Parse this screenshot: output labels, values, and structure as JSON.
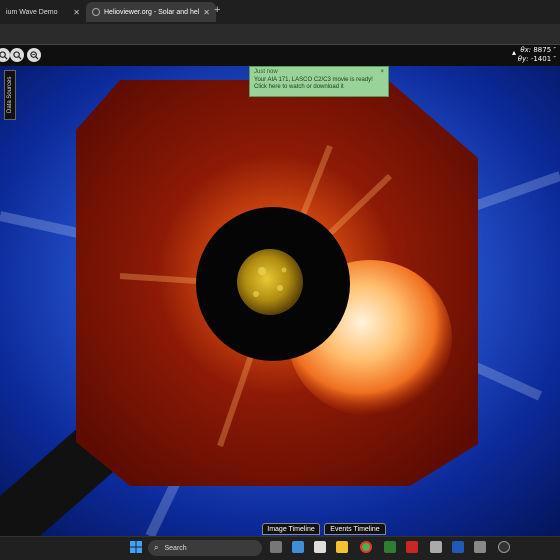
{
  "browser": {
    "tabs": [
      {
        "label": "ium Wave Demo"
      },
      {
        "label": "Helioviewer.org - Solar and hel"
      }
    ],
    "new_tab_symbol": "+",
    "close_symbol": "✕"
  },
  "toolbar": {
    "zoom_out_icon": "zoom-out-icon",
    "zoom_in_icon": "zoom-in-icon"
  },
  "coords": {
    "x_label": "θx:",
    "x_value": "8875 ″",
    "y_label": "θy:",
    "y_value": "-1401 ″"
  },
  "sidebar": {
    "data_sources_label": "Data Sources"
  },
  "notification": {
    "title": "Just now",
    "line1": "Your AIA 171, LASCO C2/C3 movie is ready!",
    "line2": "Click here to watch or download it",
    "close": "×"
  },
  "timeline": {
    "image_label": "Image Timeline",
    "events_label": "Events Timeline"
  },
  "taskbar": {
    "search_label": "Search"
  },
  "colors": {
    "background_blue": "#061a6e",
    "c2_red": "#7a1a08",
    "sun_gold": "#d4b21a",
    "notification_green": "#9ad39a"
  }
}
